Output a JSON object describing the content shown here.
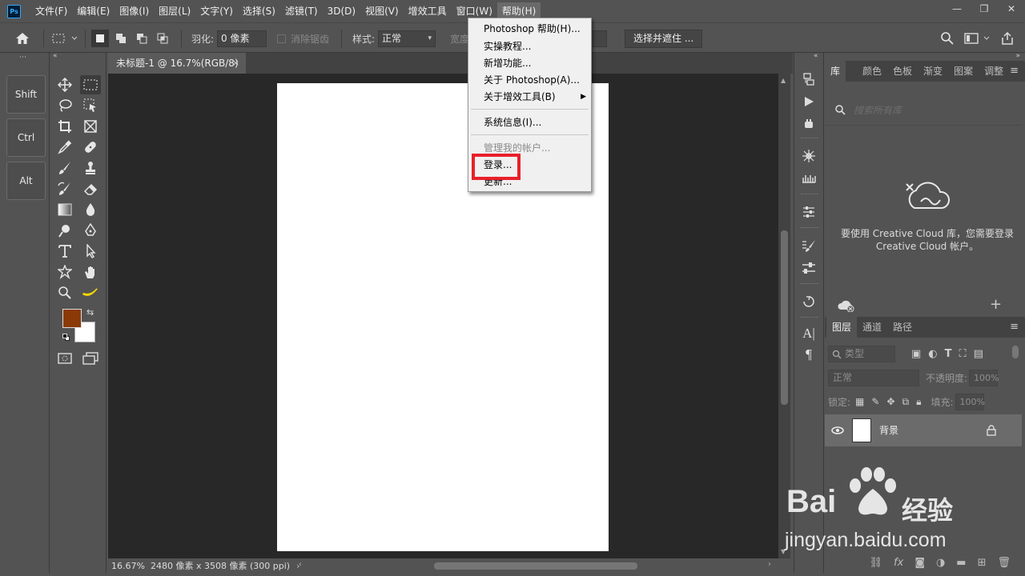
{
  "menubar": {
    "logo": "Ps",
    "items": [
      "文件(F)",
      "编辑(E)",
      "图像(I)",
      "图层(L)",
      "文字(Y)",
      "选择(S)",
      "滤镜(T)",
      "3D(D)",
      "视图(V)",
      "增效工具",
      "窗口(W)",
      "帮助(H)"
    ]
  },
  "window_controls": {
    "minimize": "—",
    "restore": "❐",
    "close": "✕"
  },
  "options": {
    "feather_label": "羽化:",
    "feather_value": "0 像素",
    "antialias_label": "消除锯齿",
    "style_label": "样式:",
    "style_value": "正常",
    "width_label": "宽度",
    "select_mask_button": "选择并遮住 ..."
  },
  "modifier_keys": [
    "Shift",
    "Ctrl",
    "Alt"
  ],
  "colors": {
    "foreground": "#8B3A07",
    "background": "#FFFFFF",
    "accent": "#31A8FF",
    "highlight": "#E8202A"
  },
  "document": {
    "tab_title": "未标题-1 @ 16.7%(RGB/8)",
    "tab_close": "×",
    "zoom": "16.67%",
    "doc_info": "2480 像素 x 3508 像素 (300 ppi)"
  },
  "help_menu": {
    "items": [
      {
        "label": "Photoshop 帮助(H)...",
        "enabled": true
      },
      {
        "label": "实操教程...",
        "enabled": true
      },
      {
        "label": "新增功能...",
        "enabled": true
      },
      {
        "label": "关于 Photoshop(A)...",
        "enabled": true
      },
      {
        "label": "关于增效工具(B)",
        "enabled": true,
        "submenu": true
      },
      {
        "label": "系统信息(I)...",
        "enabled": true
      },
      {
        "label": "管理我的帐户...",
        "enabled": false
      },
      {
        "label": "登录...",
        "enabled": true,
        "highlighted": true
      },
      {
        "label": "更新...",
        "enabled": true
      }
    ]
  },
  "libraries_panel": {
    "tabs": [
      "库",
      "颜色",
      "色板",
      "渐变",
      "图案",
      "调整"
    ],
    "active_tab": "库",
    "search_placeholder": "搜索所有库",
    "message_line1": "要使用 Creative Cloud 库，您需要登录",
    "message_line2": "Creative Cloud 帐户。"
  },
  "layers_panel": {
    "tabs": [
      "图层",
      "通道",
      "路径"
    ],
    "active_tab": "图层",
    "filter_kind": "类型",
    "blend_mode": "正常",
    "opacity_label": "不透明度:",
    "opacity_value": "100%",
    "lock_label": "锁定:",
    "fill_label": "填充:",
    "fill_value": "100%",
    "layers": [
      {
        "name": "背景",
        "visible": true,
        "locked": true
      }
    ]
  },
  "watermark": {
    "brand": "Bai",
    "brand2": "经验",
    "url": "jingyan.baidu.com"
  }
}
